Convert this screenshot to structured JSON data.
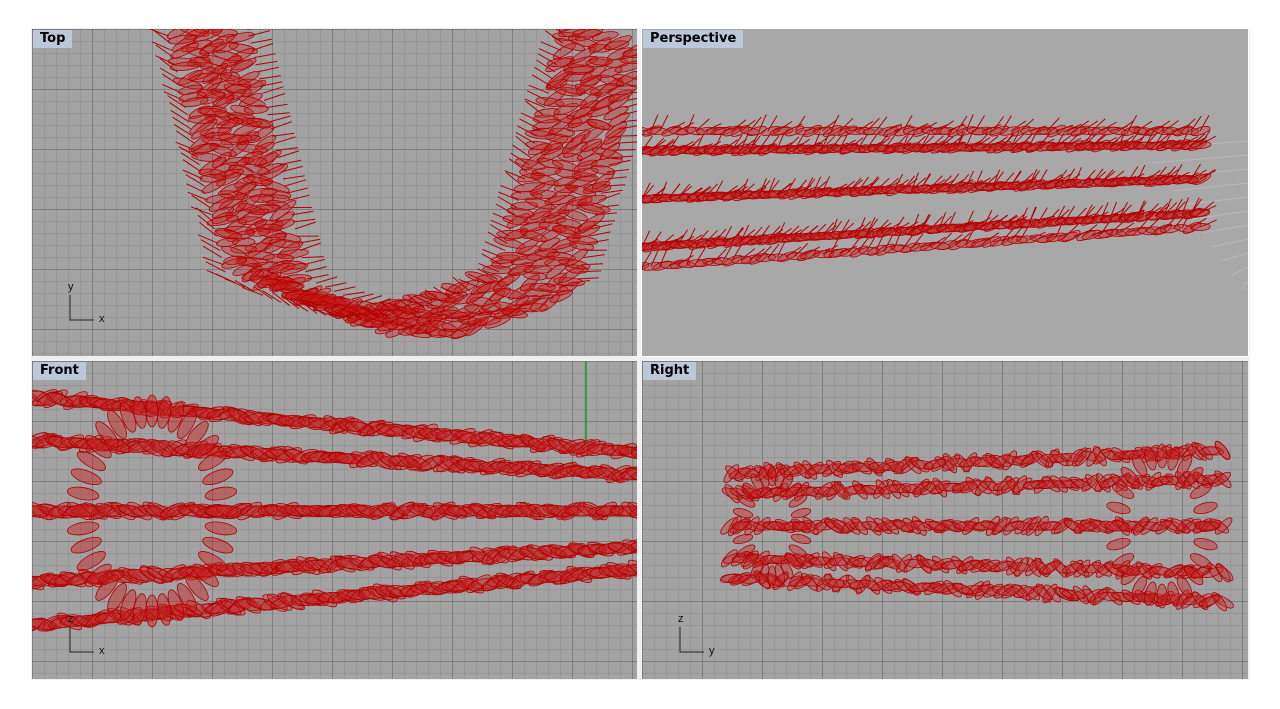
{
  "viewports": [
    {
      "id": "top",
      "label": "Top",
      "axes": {
        "vertical": "y",
        "horizontal": "x"
      }
    },
    {
      "id": "perspective",
      "label": "Perspective"
    },
    {
      "id": "front",
      "label": "Front",
      "axes": {
        "vertical": "z",
        "horizontal": "x"
      }
    },
    {
      "id": "right",
      "label": "Right",
      "axes": {
        "vertical": "z",
        "horizontal": "y"
      }
    }
  ],
  "colors": {
    "background": "#a3a3a3",
    "label_bg": "#bcc8d8",
    "geometry_stroke": "#b00000",
    "geometry_fill": "#c81e1e",
    "green_axis": "#1a9a1a"
  },
  "icons": {
    "axis_widget": "axis-icon"
  }
}
